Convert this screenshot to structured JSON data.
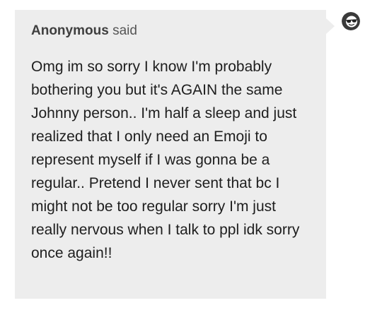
{
  "ask": {
    "asker_name": "Anonymous",
    "asker_suffix": "said",
    "body": "Omg im so sorry I know I'm probably bothering you but it's AGAIN the same Johnny person.. I'm half a sleep and just realized that I only need an Emoji to represent myself if I was gonna be a regular.. Pretend I never sent that bc I might not be too regular sorry I'm just really nervous when I talk to ppl idk sorry once again!!"
  },
  "avatar": {
    "icon": "anonymous-sunglasses-icon"
  },
  "colors": {
    "bubble_background": "#ededed",
    "asker_text": "#444444",
    "body_text": "#1e1e1e"
  }
}
